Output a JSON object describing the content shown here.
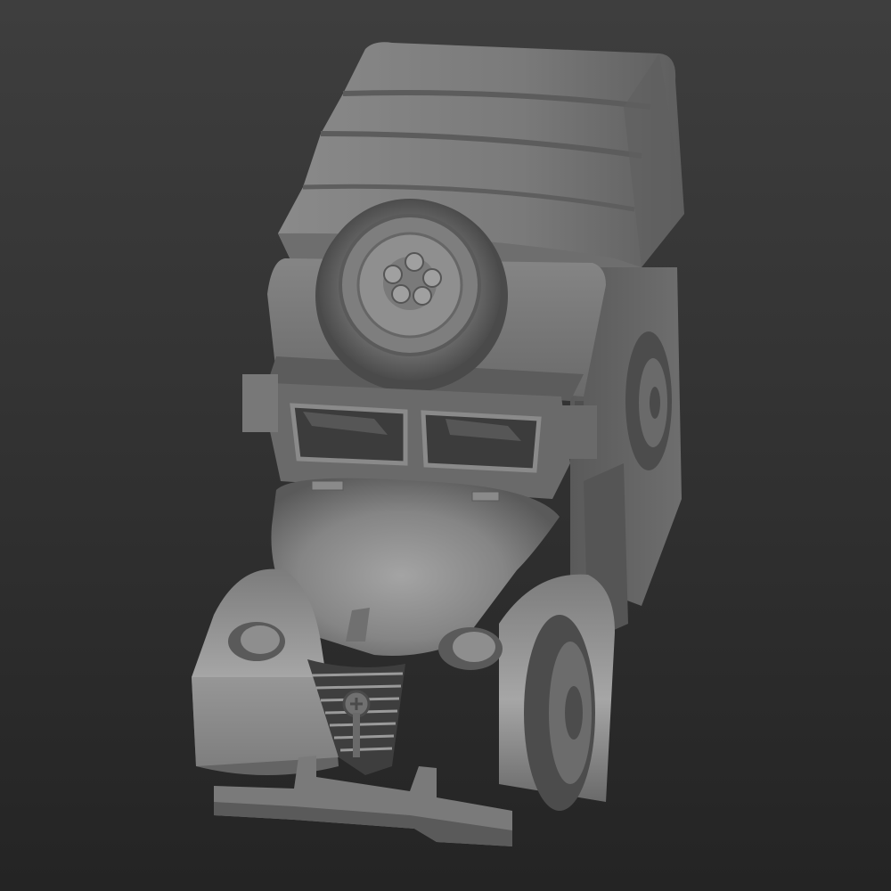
{
  "scene": {
    "subject": "3d-model-military-truck",
    "colors": {
      "background_top": "#3e3e3e",
      "background_bottom": "#242424",
      "model_light": "#9a9a9a",
      "model_mid": "#747474",
      "model_dark": "#4a4a4a",
      "model_shadow": "#2c2c2c"
    }
  }
}
